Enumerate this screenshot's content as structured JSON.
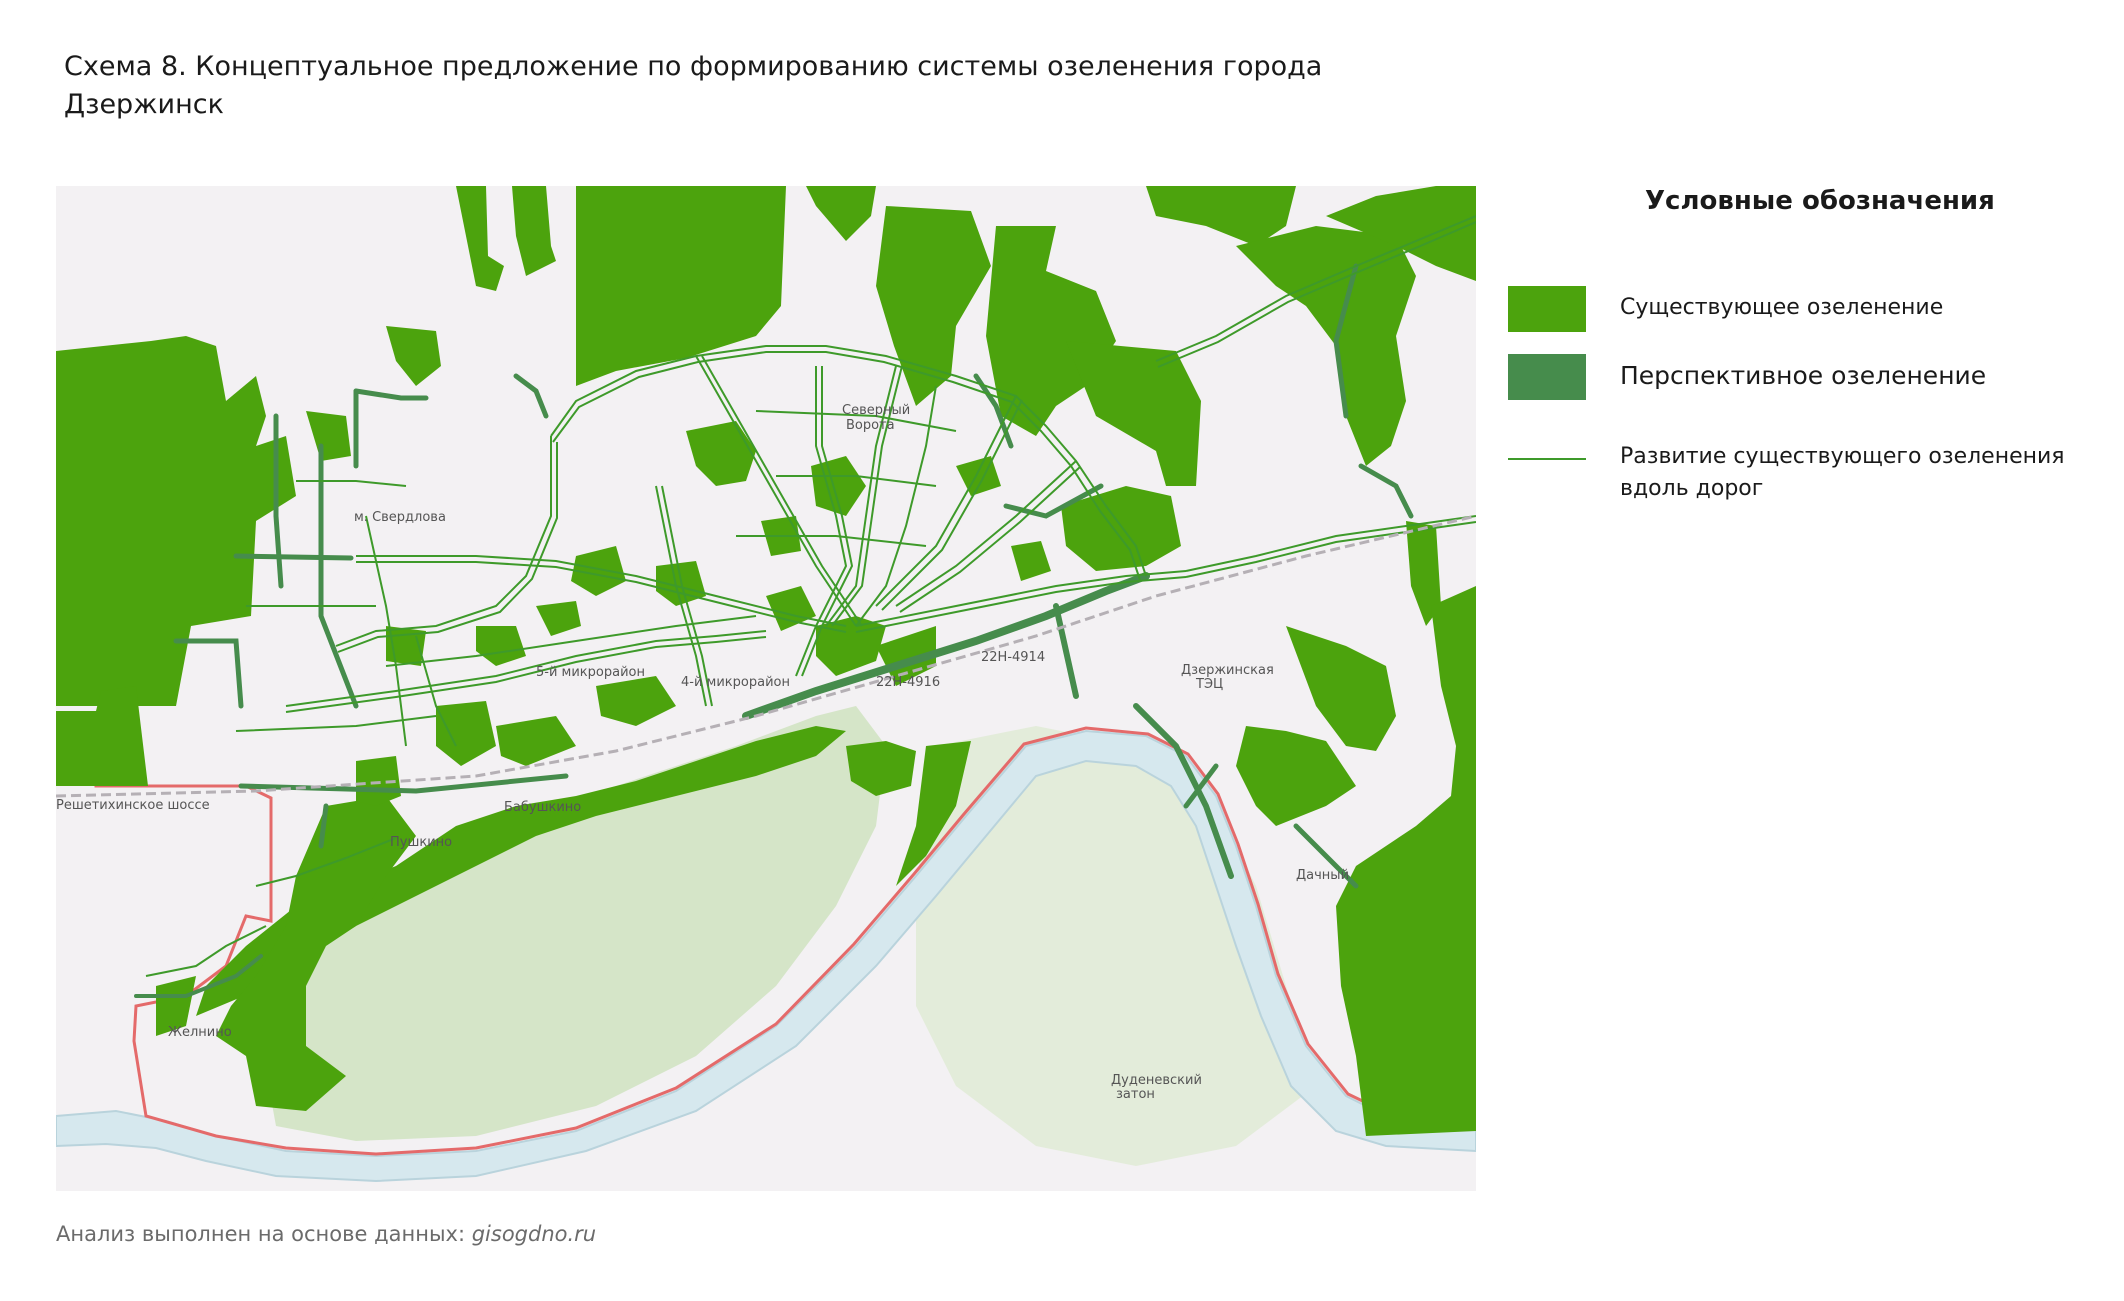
{
  "title": {
    "line1": "Схема 8. Концептуальное предложение по формированию системы озеленения города",
    "line2": "Дзержинск"
  },
  "legend": {
    "title": "Условные обозначения",
    "items": [
      {
        "label": "Существующее озеленение",
        "color": "#4ca30d"
      },
      {
        "label": "Перспективное озеленение",
        "color": "#468c4c"
      },
      {
        "label": "Развитие существующего озеленения",
        "label2": "вдоль дорог",
        "color": "#3e9a2a"
      }
    ]
  },
  "map": {
    "colors": {
      "existing": "#4ca30d",
      "perspective": "#468c4c",
      "road_green": "#3e9a2a",
      "water": "#d6e8ee",
      "water_edge": "#b9d3dc",
      "border": "#e46a6a",
      "light_green": "#cfe3bf",
      "background": "#f3f1f3"
    },
    "labels": {
      "sverdlova": "м. Свердлова",
      "severny": "Северный",
      "vorota": "Ворота",
      "babushkino": "Бабушкино",
      "pushkino": "Пушкино",
      "zhelnino": "Желнино",
      "dachny": "Дачный",
      "zaton": "Дуденевский",
      "zaton2": "затон",
      "road1": "22Н-4916",
      "road2": "22Н-4914",
      "gres": "Дзержинская",
      "gres2": "ТЭЦ",
      "mkr1": "5-й микрорайон",
      "mkr2": "4-й микрорайон",
      "reshetikha": "Решетихинское шоссе"
    }
  },
  "footer": {
    "prefix": "Анализ выполнен на основе данных: ",
    "source": "gisogdno.ru"
  }
}
